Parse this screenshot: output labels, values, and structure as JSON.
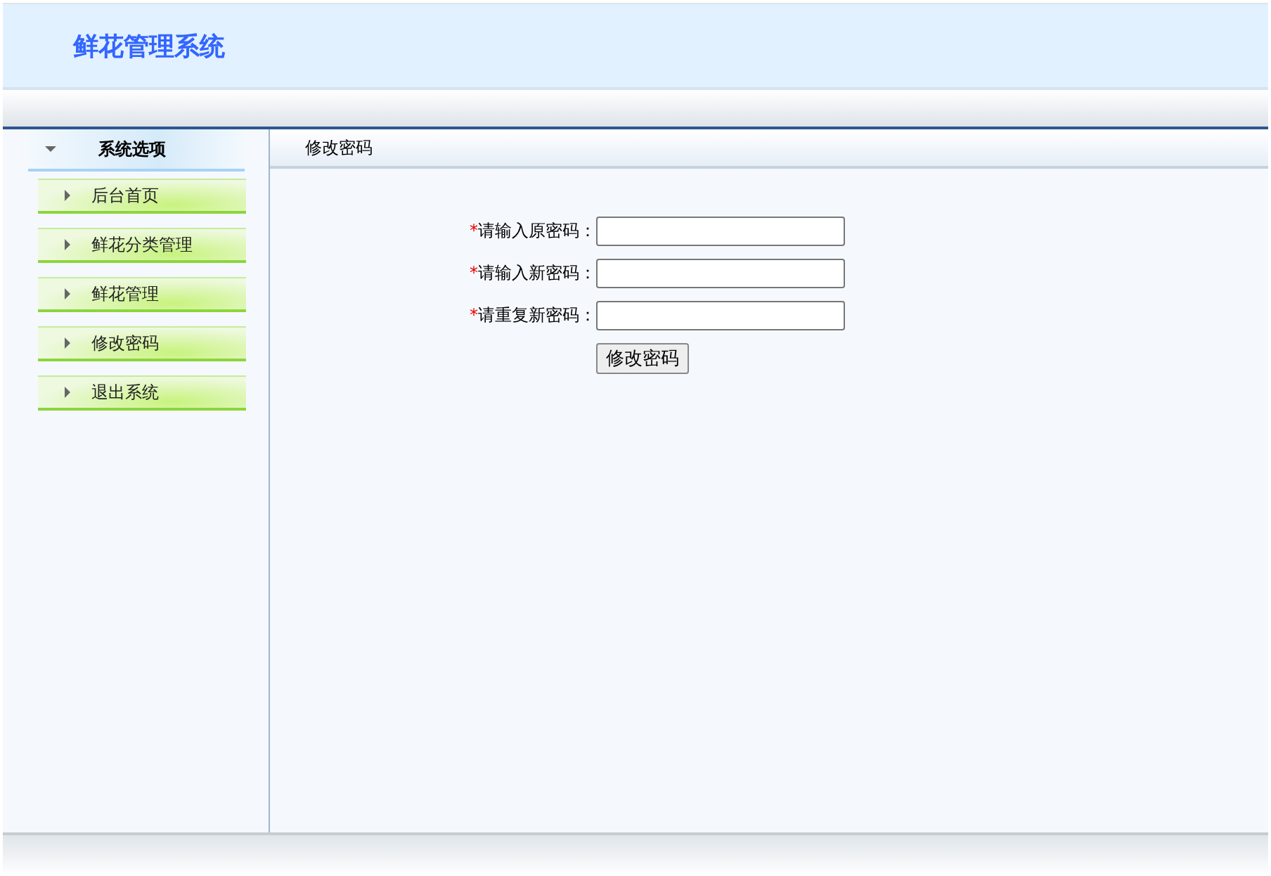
{
  "header": {
    "title": "鲜花管理系统"
  },
  "sidebar": {
    "title": "系统选项",
    "expanded": true,
    "items": [
      {
        "label": "后台首页"
      },
      {
        "label": "鲜花分类管理"
      },
      {
        "label": "鲜花管理"
      },
      {
        "label": "修改密码"
      },
      {
        "label": "退出系统"
      }
    ]
  },
  "content": {
    "title": "修改密码",
    "fields": [
      {
        "required_mark": "*",
        "label": "请输入原密码："
      },
      {
        "required_mark": "*",
        "label": "请输入新密码："
      },
      {
        "required_mark": "*",
        "label": "请重复新密码："
      }
    ],
    "button": "修改密码"
  }
}
